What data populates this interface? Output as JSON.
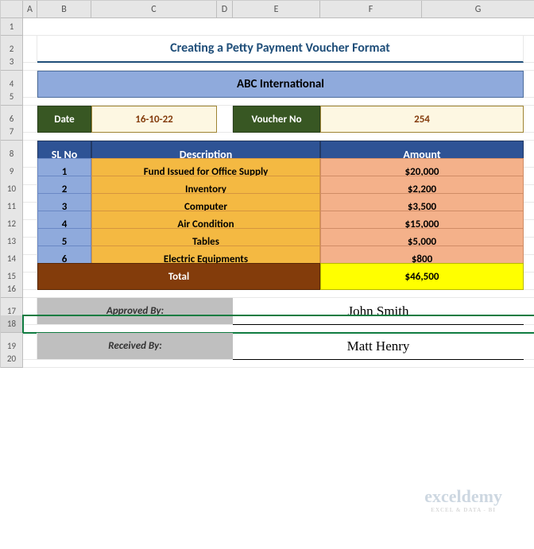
{
  "columns": [
    "",
    "A",
    "B",
    "C",
    "D",
    "E",
    "F",
    "G"
  ],
  "title": "Creating a Petty Payment Voucher Format",
  "company": "ABC International",
  "date": {
    "label": "Date",
    "value": "16-10-22"
  },
  "voucher": {
    "label": "Voucher No",
    "value": "254"
  },
  "headers": {
    "sl": "SL No",
    "desc": "Description",
    "amt": "Amount"
  },
  "rows": [
    {
      "sl": "1",
      "desc": "Fund Issued for Office Supply",
      "amt": "$20,000"
    },
    {
      "sl": "2",
      "desc": "Inventory",
      "amt": "$2,200"
    },
    {
      "sl": "3",
      "desc": "Computer",
      "amt": "$3,500"
    },
    {
      "sl": "4",
      "desc": "Air Condition",
      "amt": "$15,000"
    },
    {
      "sl": "5",
      "desc": "Tables",
      "amt": "$5,000"
    },
    {
      "sl": "6",
      "desc": "Electric Equipments",
      "amt": "$800"
    }
  ],
  "total": {
    "label": "Total",
    "value": "$46,500"
  },
  "approved": {
    "label": "Approved By:",
    "name": "John Smith"
  },
  "received": {
    "label": "Received By:",
    "name": "Matt Henry"
  },
  "watermark": {
    "brand": "exceldemy",
    "tag": "EXCEL & DATA - BI"
  },
  "chart_data": {
    "type": "table",
    "title": "Petty Payment Voucher",
    "columns": [
      "SL No",
      "Description",
      "Amount"
    ],
    "rows": [
      [
        1,
        "Fund Issued for Office Supply",
        20000
      ],
      [
        2,
        "Inventory",
        2200
      ],
      [
        3,
        "Computer",
        3500
      ],
      [
        4,
        "Air Condition",
        15000
      ],
      [
        5,
        "Tables",
        5000
      ],
      [
        6,
        "Electric Equipments",
        800
      ]
    ],
    "total": 46500
  }
}
